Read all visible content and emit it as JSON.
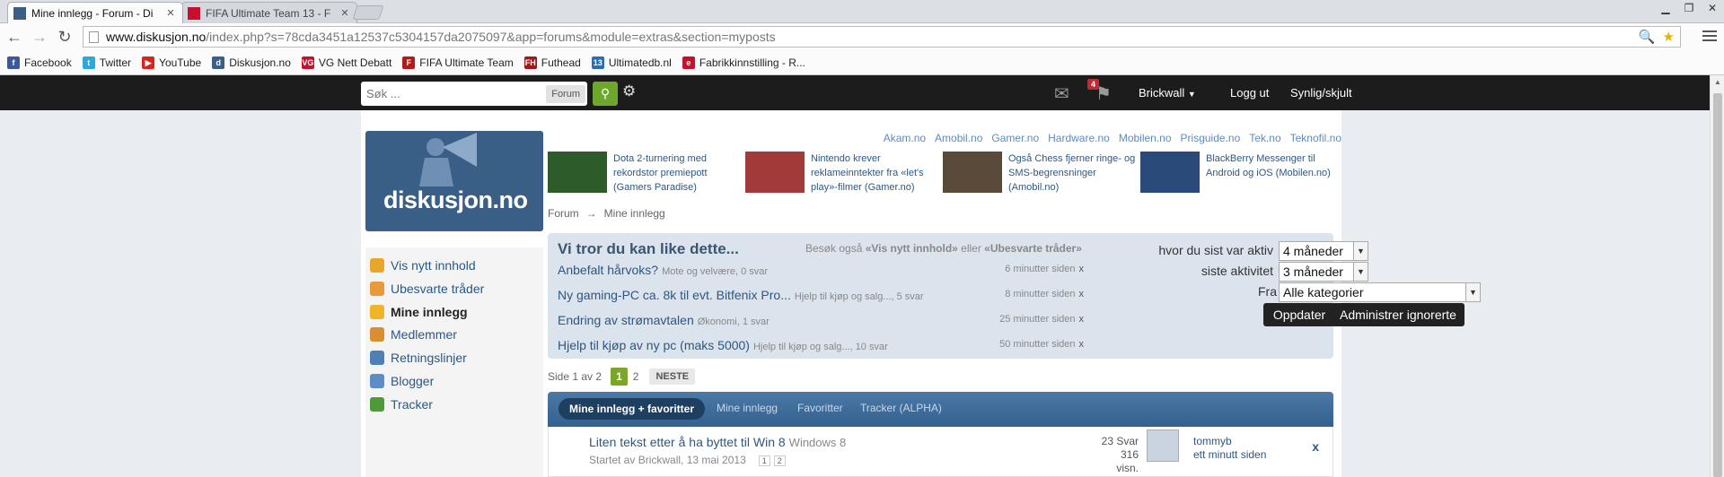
{
  "browser": {
    "tabs": [
      {
        "title": "Mine innlegg - Forum - Di",
        "active": true,
        "favicon": "diskusjon-favicon"
      },
      {
        "title": "FIFA Ultimate Team 13 - F",
        "active": false,
        "favicon": "vg-favicon"
      }
    ],
    "url_host": "www.diskusjon.no",
    "url_path": "/index.php?s=78cda3451a12537c5304157da2075097&app=forums&module=extras&section=myposts",
    "bookmarks": [
      {
        "label": "Facebook",
        "icon": "facebook-icon",
        "color": "#3b5998",
        "glyph": "f"
      },
      {
        "label": "Twitter",
        "icon": "twitter-icon",
        "color": "#2aa9e0",
        "glyph": "t"
      },
      {
        "label": "YouTube",
        "icon": "youtube-icon",
        "color": "#d9261c",
        "glyph": "▶"
      },
      {
        "label": "Diskusjon.no",
        "icon": "diskusjon-icon",
        "color": "#3a5f86",
        "glyph": "d"
      },
      {
        "label": "VG Nett Debatt",
        "icon": "vg-icon",
        "color": "#c8102e",
        "glyph": "VG"
      },
      {
        "label": "FIFA Ultimate Team",
        "icon": "fifa-icon",
        "color": "#b01c1c",
        "glyph": "F"
      },
      {
        "label": "Futhead",
        "icon": "futhead-icon",
        "color": "#a01818",
        "glyph": "FH"
      },
      {
        "label": "Ultimatedb.nl",
        "icon": "ultimatedb-icon",
        "color": "#2a6fb5",
        "glyph": "13"
      },
      {
        "label": "Fabrikkinnstilling - R...",
        "icon": "fabrikk-icon",
        "color": "#c8102e",
        "glyph": "e"
      }
    ]
  },
  "sitebar": {
    "search_placeholder": "Søk ...",
    "search_scope": "Forum",
    "notifications_count": "4",
    "username": "Brickwall",
    "logout": "Logg ut",
    "visibility": "Synlig/skjult"
  },
  "sidebar": {
    "items": [
      {
        "label": "Vis nytt innhold",
        "icon": "new-content-icon",
        "color": "#e8a72a"
      },
      {
        "label": "Ubesvarte tråder",
        "icon": "unanswered-icon",
        "color": "#e89a3a"
      },
      {
        "label": "Mine innlegg",
        "icon": "my-posts-icon",
        "color": "#f0b429"
      },
      {
        "label": "Medlemmer",
        "icon": "members-icon",
        "color": "#d98f2f"
      },
      {
        "label": "Retningslinjer",
        "icon": "guidelines-icon",
        "color": "#4f7fb8"
      },
      {
        "label": "Blogger",
        "icon": "blog-icon",
        "color": "#5b8dc9"
      },
      {
        "label": "Tracker",
        "icon": "tracker-icon",
        "color": "#4e9a3a"
      }
    ]
  },
  "logo_text": "diskusjon.no",
  "network_sites": [
    "Akam.no",
    "Amobil.no",
    "Gamer.no",
    "Hardware.no",
    "Mobilen.no",
    "Prisguide.no",
    "Tek.no",
    "Teknofil.no"
  ],
  "news": [
    {
      "text": "Dota 2-turnering med rekordstor premiepott (Gamers Paradise)",
      "color": "#2d5b2a"
    },
    {
      "text": "Nintendo krever reklameinntekter fra «let's play»-filmer (Gamer.no)",
      "color": "#a33a3a"
    },
    {
      "text": "Også Chess fjerner ringe- og SMS-begrensninger (Amobil.no)",
      "color": "#5a4a3a"
    },
    {
      "text": "BlackBerry Messenger til Android og iOS (Mobilen.no)",
      "color": "#2a4a7a"
    }
  ],
  "breadcrumb": {
    "root": "Forum",
    "arrow": "→",
    "current": "Mine innlegg"
  },
  "suggestions": {
    "title": "Vi tror du kan like dette...",
    "also_prefix": "Besøk også ",
    "also_link1": "«Vis nytt innhold»",
    "also_mid": " eller ",
    "also_link2": "«Ubesvarte tråder»",
    "rows": [
      {
        "title": "Anbefalt hårvoks?",
        "meta": "Mote og velvære, 0 svar",
        "time": "6 minutter siden"
      },
      {
        "title": "Ny gaming-PC ca. 8k til evt. Bitfenix Pro...",
        "meta": "Hjelp til kjøp og salg..., 5 svar",
        "time": "8 minutter siden"
      },
      {
        "title": "Endring av strømavtalen",
        "meta": "Økonomi, 1 svar",
        "time": "25 minutter siden"
      },
      {
        "title": "Hjelp til kjøp av ny pc (maks 5000)",
        "meta": "Hjelp til kjøp og salg..., 10 svar",
        "time": "50 minutter siden"
      }
    ],
    "remove_glyph": "x"
  },
  "filters": {
    "last_active_label": "hvor du sist var aktiv",
    "last_active_value": "4 måneder",
    "last_activity_label": "siste aktivitet",
    "last_activity_value": "3 måneder",
    "from_label": "Fra",
    "from_value": "Alle kategorier",
    "update_button": "Oppdater",
    "manage_button": "Administrer ignorerte"
  },
  "pager": {
    "prefix": "Side",
    "page_of": "1 av 2",
    "current": "1",
    "other": "2",
    "next": "NESTE"
  },
  "list_tabs": [
    "Mine innlegg + favoritter",
    "Mine innlegg",
    "Favoritter",
    "Tracker (ALPHA)"
  ],
  "topic": {
    "title": "Liten tekst etter å ha byttet til Win 8",
    "forum": "Windows 8",
    "started": "Startet av Brickwall, 13 mai 2013",
    "pages": [
      "1",
      "2"
    ],
    "replies": "23 Svar",
    "views": "316 visn.",
    "last_user": "tommyb",
    "last_time": "ett minutt siden",
    "remove": "x"
  }
}
